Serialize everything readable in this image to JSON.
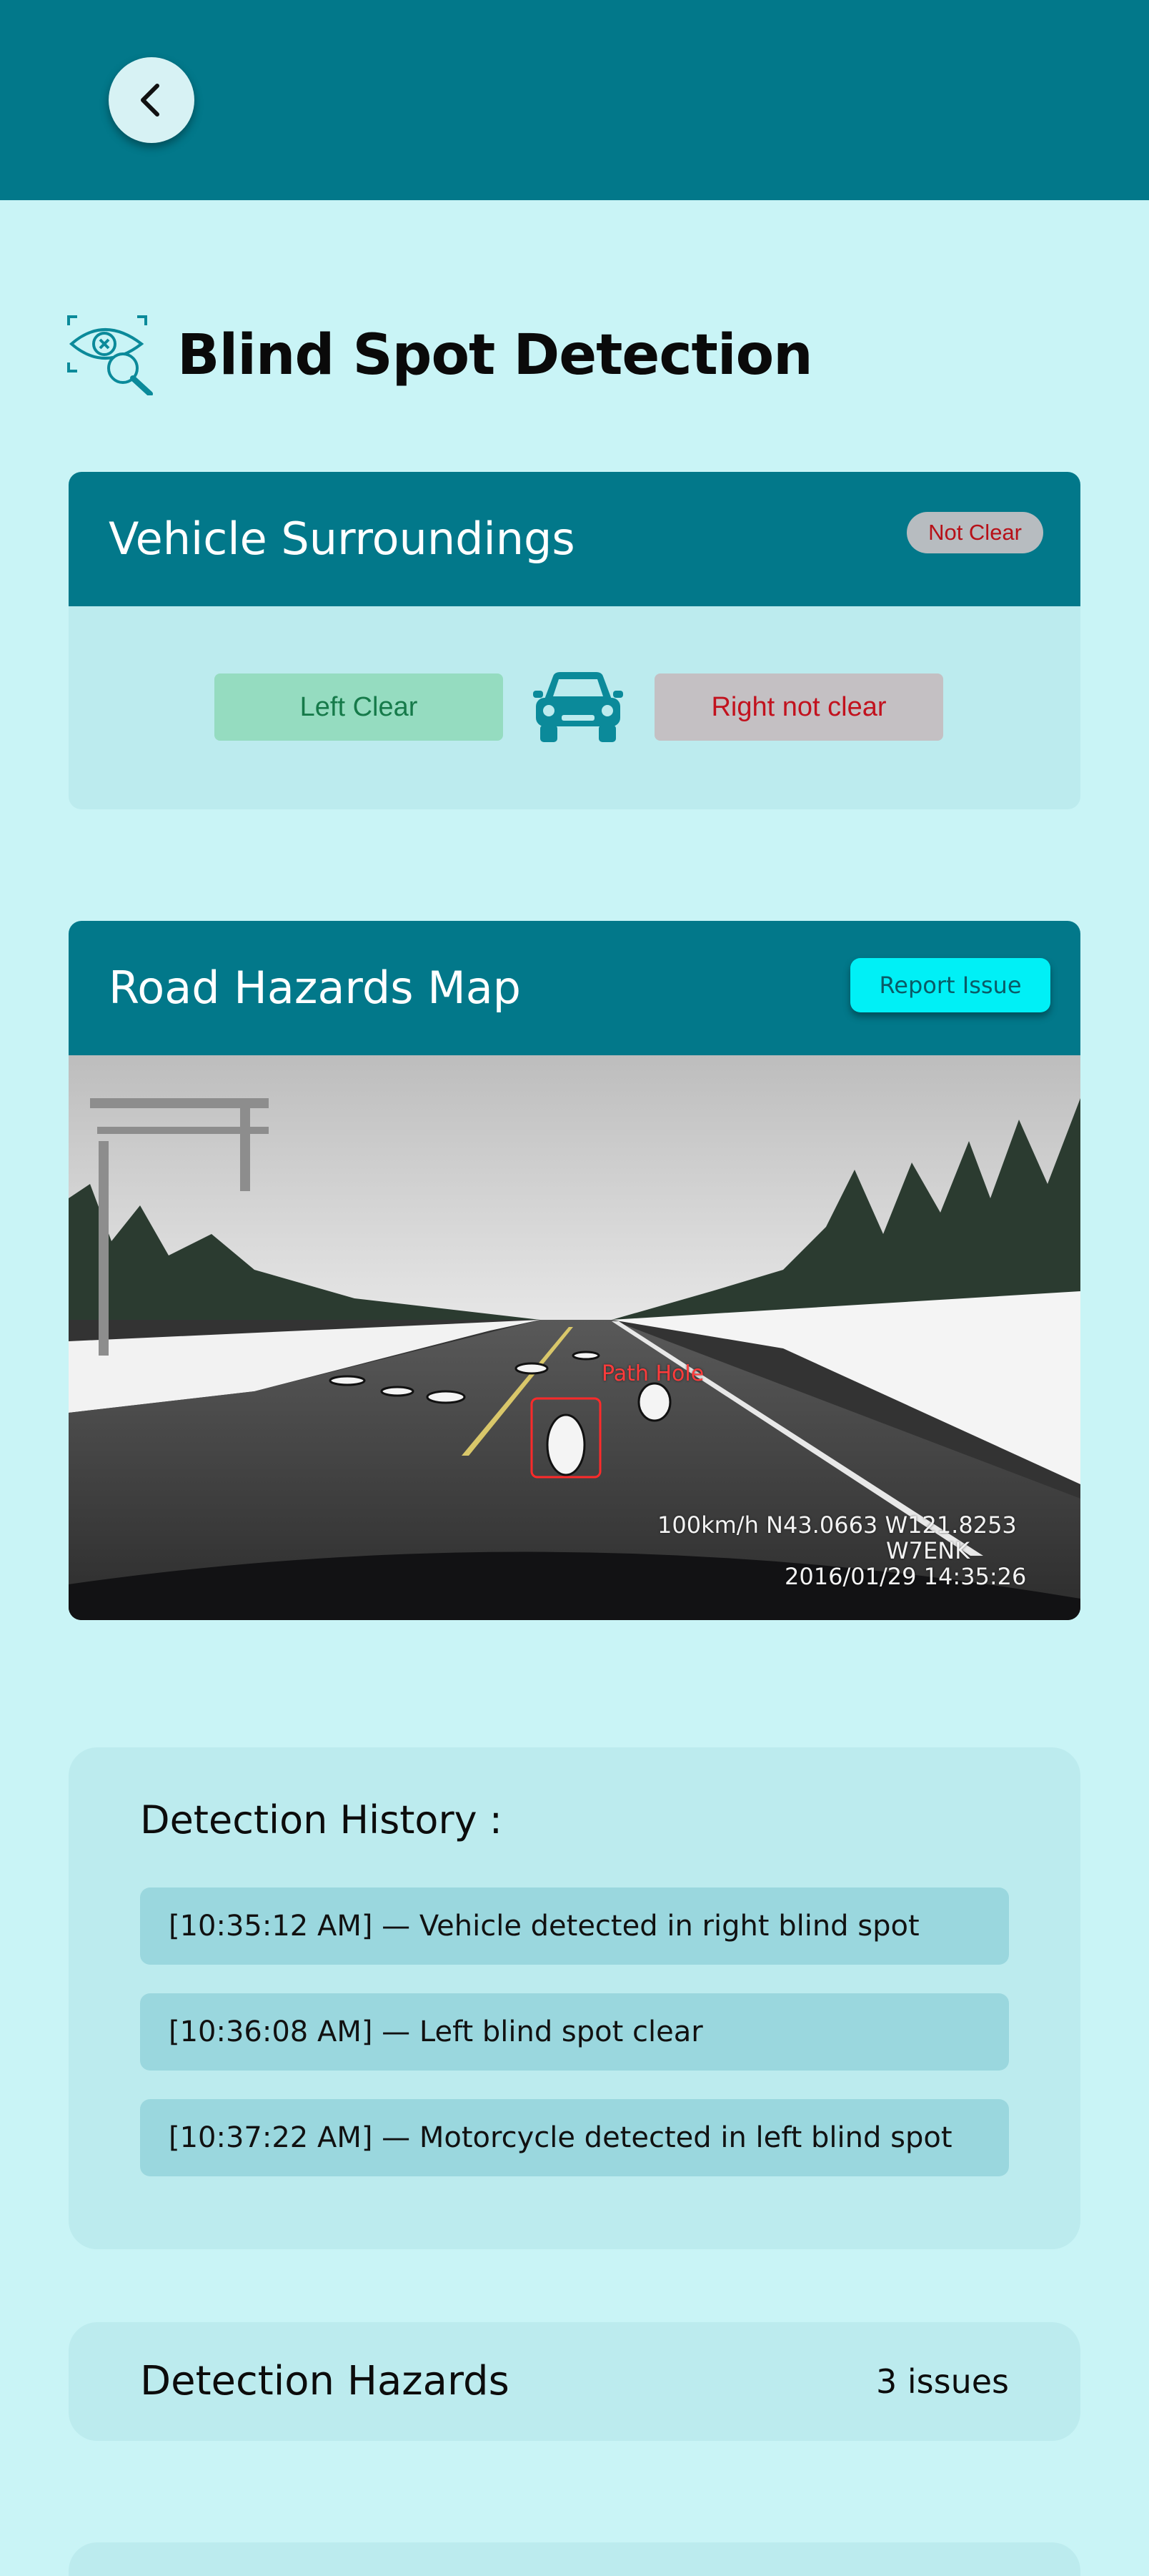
{
  "header": {
    "back_icon": "chevron-left-icon"
  },
  "page": {
    "title": "Blind Spot Detection",
    "icon": "eye-search-icon"
  },
  "surroundings": {
    "title": "Vehicle Surroundings",
    "status_badge": "Not Clear",
    "left_status": "Left Clear",
    "right_status": "Right not clear",
    "car_icon": "car-icon",
    "colors": {
      "clear": "#167a4a",
      "not_clear": "#c2121e"
    }
  },
  "hazard_map": {
    "title": "Road Hazards Map",
    "report_button": "Report Issue",
    "detection_label": "Path Hole",
    "speed_coords": "100km/h N43.0663 W121.8253",
    "callsign": "W7ENK",
    "timestamp": "2016/01/29 14:35:26"
  },
  "history": {
    "title": "Detection History :",
    "items": [
      "[10:35:12 AM] — Vehicle detected in right blind spot",
      "[10:36:08 AM] — Left blind spot clear",
      "[10:37:22 AM] — Motorcycle detected in left blind spot"
    ]
  },
  "hazards": {
    "label": "Detection Hazards",
    "count": "3 issues"
  },
  "theme": {
    "primary": "#02788a",
    "background": "#c9f4f6",
    "accent": "#00f0f6"
  }
}
